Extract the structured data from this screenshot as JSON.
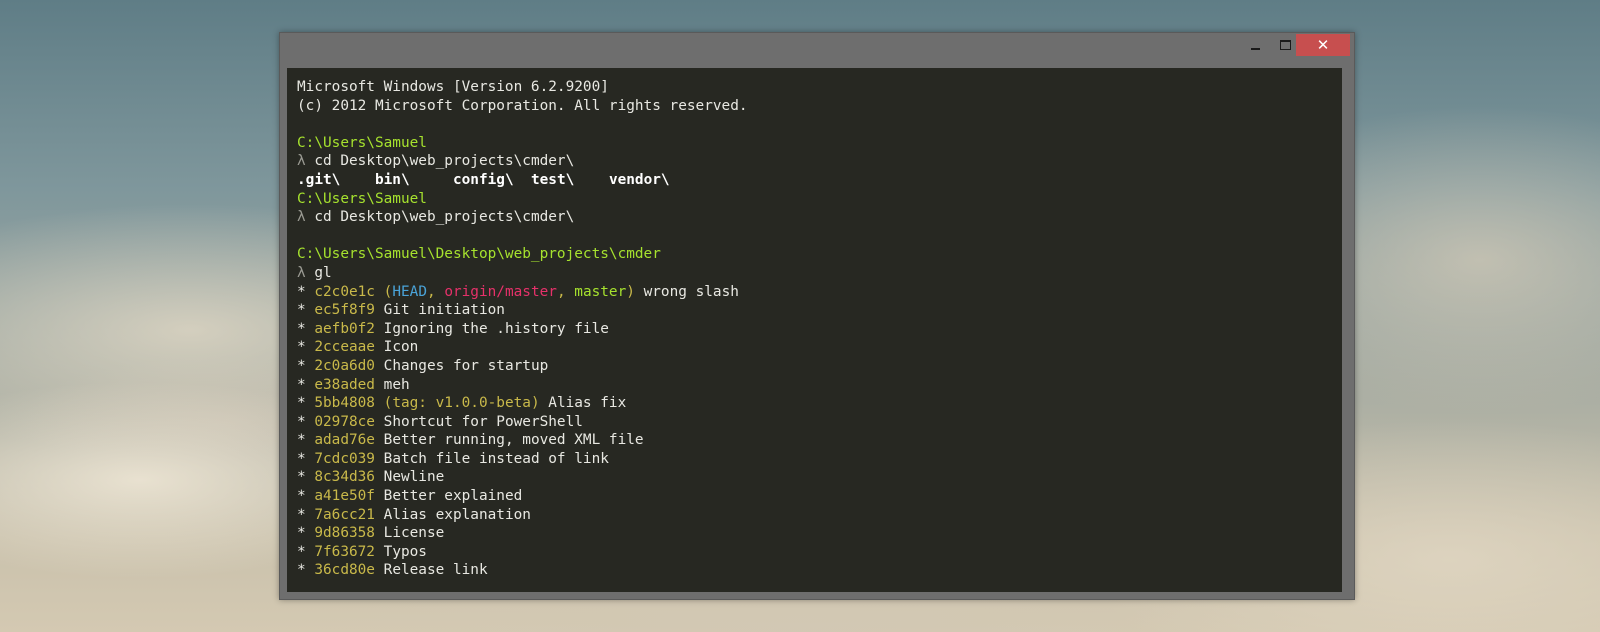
{
  "window": {
    "buttons": {
      "minimize": "minimize-icon",
      "maximize": "maximize-icon",
      "close": "✕"
    }
  },
  "console": {
    "header": [
      "Microsoft Windows [Version 6.2.9200]",
      "(c) 2012 Microsoft Corporation. All rights reserved."
    ],
    "prompt1": "C:\\Users\\Samuel",
    "lambda": "λ",
    "cmd1": "cd Desktop\\web_projects\\cmder\\",
    "dirs": [
      ".git\\",
      "bin\\",
      "config\\",
      "test\\",
      "vendor\\"
    ],
    "prompt2": "C:\\Users\\Samuel",
    "cmd2": "cd Desktop\\web_projects\\cmder\\",
    "prompt3": "C:\\Users\\Samuel\\Desktop\\web_projects\\cmder",
    "cmd3": "gl",
    "log": [
      {
        "hash": "c2c0e1c",
        "refs": {
          "head": "HEAD",
          "origin": "origin/master",
          "master": "master"
        },
        "msg": "wrong slash"
      },
      {
        "hash": "ec5f8f9",
        "msg": "Git initiation"
      },
      {
        "hash": "aefb0f2",
        "msg": "Ignoring the .history file"
      },
      {
        "hash": "2cceaae",
        "msg": "Icon"
      },
      {
        "hash": "2c0a6d0",
        "msg": "Changes for startup"
      },
      {
        "hash": "e38aded",
        "msg": "meh"
      },
      {
        "hash": "5bb4808",
        "tag": "(tag: v1.0.0-beta)",
        "msg": "Alias fix"
      },
      {
        "hash": "02978ce",
        "msg": "Shortcut for PowerShell"
      },
      {
        "hash": "adad76e",
        "msg": "Better running, moved XML file"
      },
      {
        "hash": "7cdc039",
        "msg": "Batch file instead of link"
      },
      {
        "hash": "8c34d36",
        "msg": "Newline"
      },
      {
        "hash": "a41e50f",
        "msg": "Better explained"
      },
      {
        "hash": "7a6cc21",
        "msg": "Alias explanation"
      },
      {
        "hash": "9d86358",
        "msg": "License"
      },
      {
        "hash": "7f63672",
        "msg": "Typos"
      },
      {
        "hash": "36cd80e",
        "msg": "Release link"
      }
    ]
  },
  "colors": {
    "console_bg": "#272822",
    "path": "#a6e22e",
    "hash": "#c9b94a",
    "head": "#4aa3d8",
    "origin": "#e6316a",
    "close_button": "#c74f4f"
  }
}
